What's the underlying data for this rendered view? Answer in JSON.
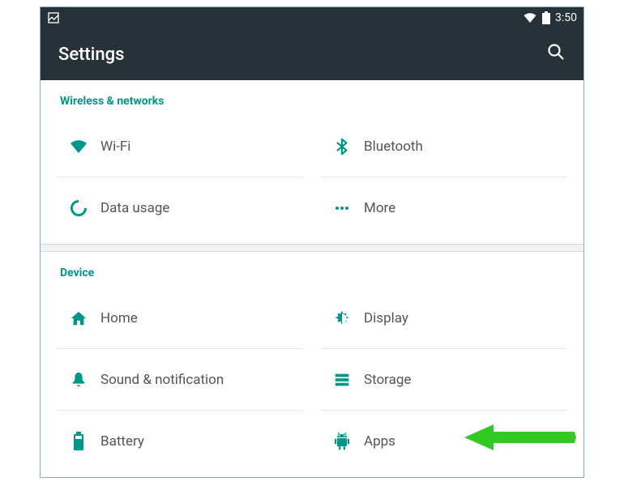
{
  "status": {
    "time": "3:50"
  },
  "appbar": {
    "title": "Settings"
  },
  "sections": {
    "wireless": {
      "header": "Wireless & networks",
      "wifi": "Wi-Fi",
      "bluetooth": "Bluetooth",
      "data": "Data usage",
      "more": "More"
    },
    "device": {
      "header": "Device",
      "home": "Home",
      "display": "Display",
      "sound": "Sound & notification",
      "storage": "Storage",
      "battery": "Battery",
      "apps": "Apps"
    }
  }
}
